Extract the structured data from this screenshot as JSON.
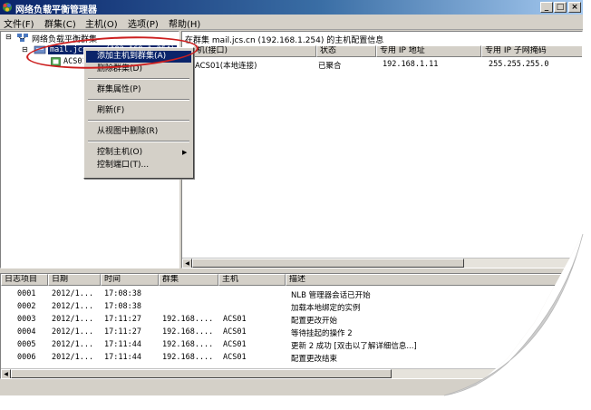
{
  "window": {
    "title": "网络负载平衡管理器"
  },
  "menu": {
    "items": [
      "文件(F)",
      "群集(C)",
      "主机(O)",
      "选项(P)",
      "帮助(H)"
    ]
  },
  "tree": {
    "root": "网络负载平衡群集",
    "cluster": "mail.jcs.cn (192.168.1.254)",
    "host": "ACS01"
  },
  "context_menu": {
    "items": [
      "添加主机到群集(A)",
      "删除群集(D)",
      "群集属性(P)",
      "刷新(F)",
      "从视图中删除(R)",
      "控制主机(O)",
      "控制端口(T)..."
    ],
    "submenu_arrow": "▶"
  },
  "detail": {
    "caption": "在群集 mail.jcs.cn (192.168.1.254) 的主机配置信息",
    "columns": [
      "机(接口)",
      "状态",
      "专用 IP 地址",
      "专用 IP 子网掩码"
    ],
    "rows": [
      [
        "ACS01(本地连接)",
        "已聚合",
        "192.168.1.11",
        "255.255.255.0"
      ]
    ]
  },
  "log": {
    "columns": [
      "日志项目",
      "日期",
      "时间",
      "群集",
      "主机",
      "描述"
    ],
    "rows": [
      [
        "0001",
        "2012/1...",
        "17:08:38",
        "",
        "",
        "NLB 管理器会话已开始"
      ],
      [
        "0002",
        "2012/1...",
        "17:08:38",
        "",
        "",
        "加载本地绑定的实例"
      ],
      [
        "0003",
        "2012/1...",
        "17:11:27",
        "192.168....",
        "ACS01",
        "配置更改开始"
      ],
      [
        "0004",
        "2012/1...",
        "17:11:27",
        "192.168....",
        "ACS01",
        "等待挂起的操作 2"
      ],
      [
        "0005",
        "2012/1...",
        "17:11:44",
        "192.168....",
        "ACS01",
        "更新 2 成功 [双击以了解详细信息...]"
      ],
      [
        "0006",
        "2012/1...",
        "17:11:44",
        "192.168....",
        "ACS01",
        "配置更改结束"
      ]
    ]
  },
  "colors": {
    "title_start": "#0a246a",
    "title_end": "#a6caf0",
    "highlight": "#0a246a",
    "annotation": "#cc1f1f",
    "chrome": "#d4d0c8"
  }
}
